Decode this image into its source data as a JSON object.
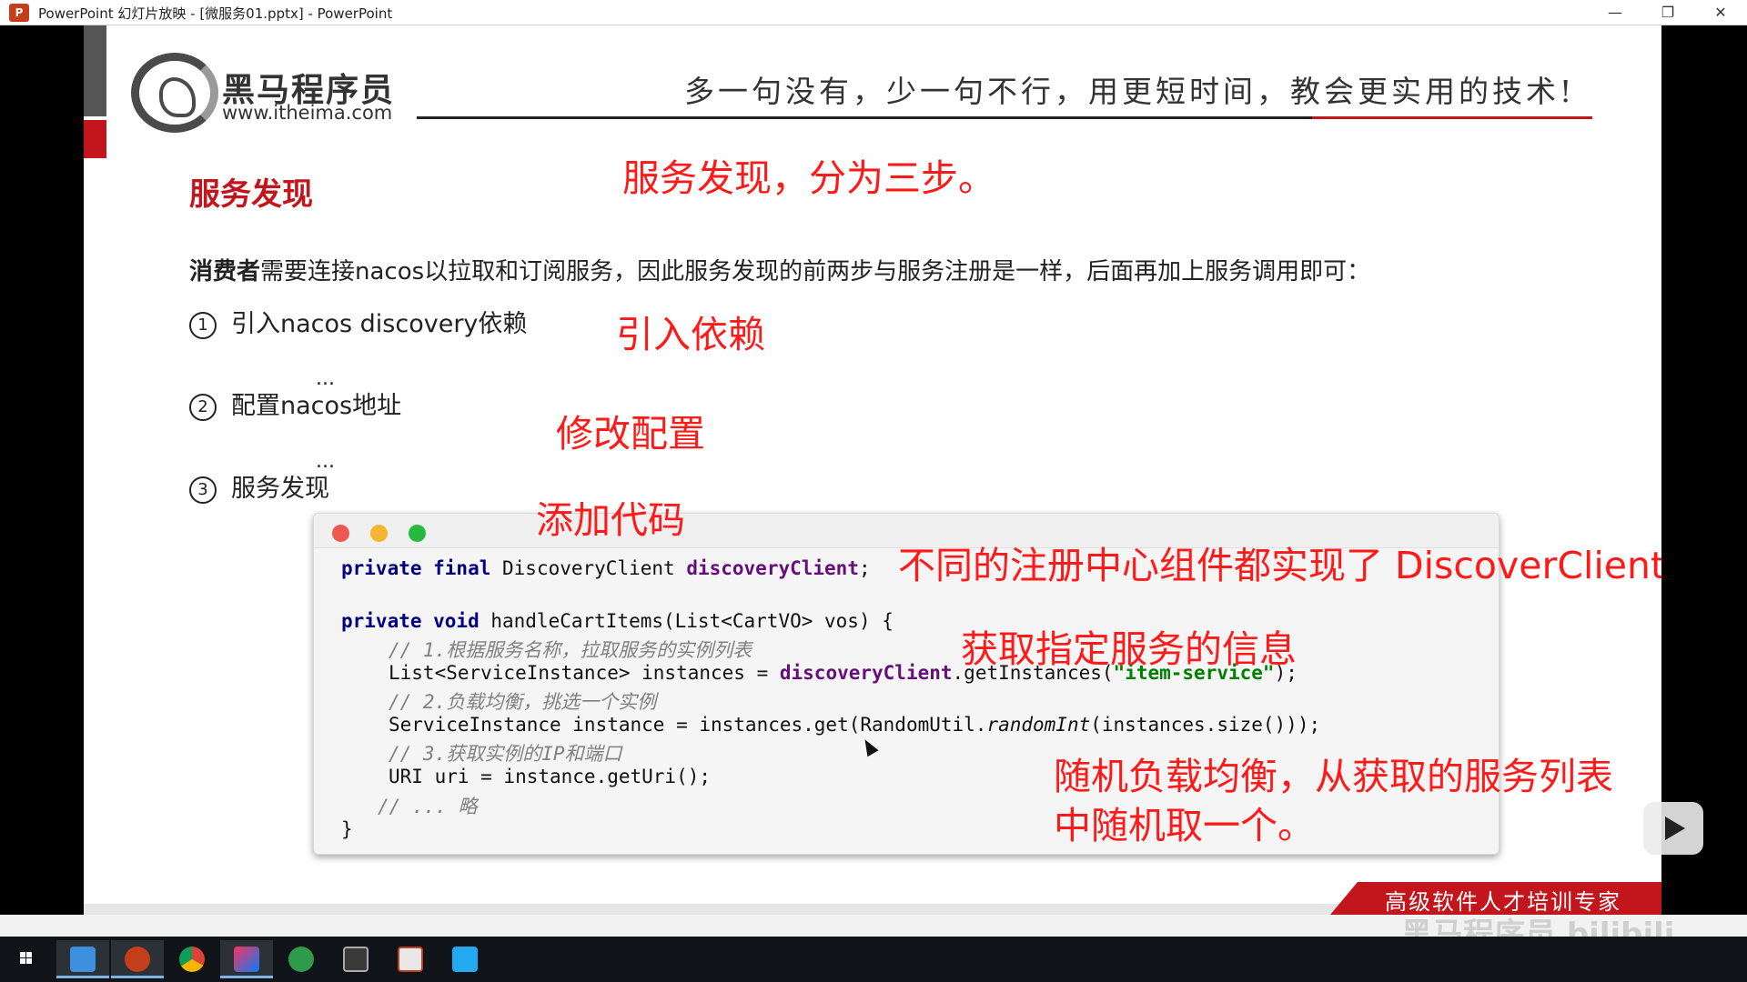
{
  "window": {
    "title": "PowerPoint 幻灯片放映 - [微服务01.pptx] - PowerPoint",
    "minimize_glyph": "—",
    "restore_glyph": "❐",
    "close_glyph": "✕"
  },
  "slide": {
    "brand_name": "黑马程序员",
    "brand_url": "www.itheima.com",
    "slogan": "多一句没有，少一句不行，用更短时间，教会更实用的技术!",
    "title": "服务发现",
    "intro_bold": "消费者",
    "intro_rest": "需要连接nacos以拉取和订阅服务，因此服务发现的前两步与服务注册是一样，后面再加上服务调用即可：",
    "steps": [
      {
        "num": "1",
        "text": "引入nacos discovery依赖"
      },
      {
        "num": "2",
        "text": "配置nacos地址"
      },
      {
        "num": "3",
        "text": "服务发现"
      }
    ],
    "ellipsis": "...",
    "footer": "高级软件人才培训专家"
  },
  "annotations": {
    "headline": "服务发现，分为三步。",
    "step1": "引入依赖",
    "step2": "修改配置",
    "step3": "添加代码",
    "interface": "不同的注册中心组件都实现了 DiscoverClient 接口",
    "get_info": "获取指定服务的信息",
    "random_line1": "随机负载均衡，从获取的服务列表",
    "random_line2": "中随机取一个。"
  },
  "code": {
    "l1_kw": "private final",
    "l1_type": " DiscoveryClient ",
    "l1_field": "discoveryClient",
    "l1_end": ";",
    "l2_kw": "private void",
    "l2_rest": " handleCartItems(List<CartVO> vos) {",
    "c1": "// 1.根据服务名称，拉取服务的实例列表",
    "l3_a": "List<ServiceInstance> instances = ",
    "l3_field": "discoveryClient",
    "l3_b": ".getInstances(",
    "l3_str": "\"item-service\"",
    "l3_c": ");",
    "c2": "// 2.负载均衡，挑选一个实例",
    "l4_a": "ServiceInstance instance = instances.get(RandomUtil.",
    "l4_it": "randomInt",
    "l4_b": "(instances.size()));",
    "c3": "// 3.获取实例的IP和端口",
    "l5": "URI uri = instance.getUri();",
    "c4": "// ... 略",
    "close": "}"
  },
  "overlay": {
    "watermark": "黑马程序员 bilibili"
  },
  "taskbar": {
    "items": [
      "start",
      "file-explorer",
      "powerpoint",
      "chrome",
      "intellij-idea",
      "hbuilder",
      "terminal",
      "screenshot-tool",
      "vscode"
    ]
  },
  "colors": {
    "brand_red": "#c3161c",
    "annotation_red": "#ff1a1a",
    "keyword": "#000080",
    "field": "#660e7a",
    "string": "#008000",
    "comment": "#808080"
  }
}
